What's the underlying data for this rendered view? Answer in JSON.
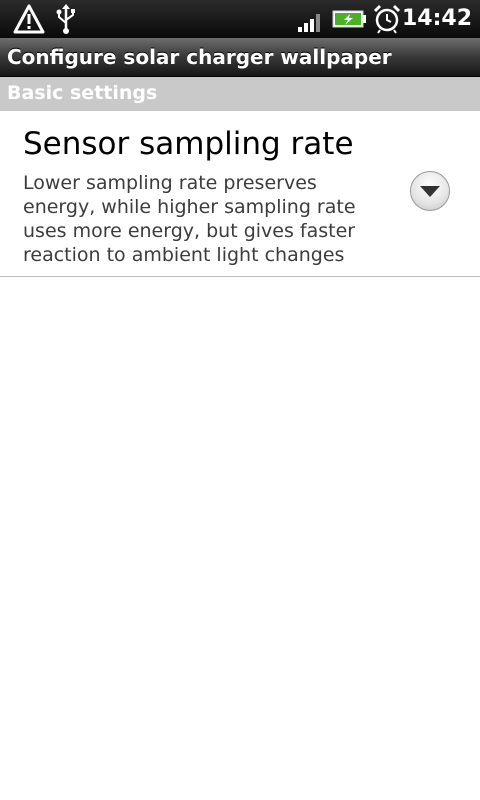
{
  "status_bar": {
    "time": "14:42",
    "icons": [
      "warning-icon",
      "usb-icon",
      "signal-icon",
      "battery-charging-icon",
      "alarm-icon"
    ]
  },
  "title_bar": {
    "title": "Configure solar charger wallpaper"
  },
  "section": {
    "label": "Basic settings"
  },
  "preference": {
    "title": "Sensor sampling rate",
    "summary": "Lower sampling rate preserves energy, while higher sampling rate uses more energy, but gives faster reaction to ambient light changes",
    "control_icon": "chevron-down-icon"
  },
  "colors": {
    "status_bar": "#0a0a0a",
    "section_header": "#c9c9c9",
    "battery": "#4caf2a"
  }
}
